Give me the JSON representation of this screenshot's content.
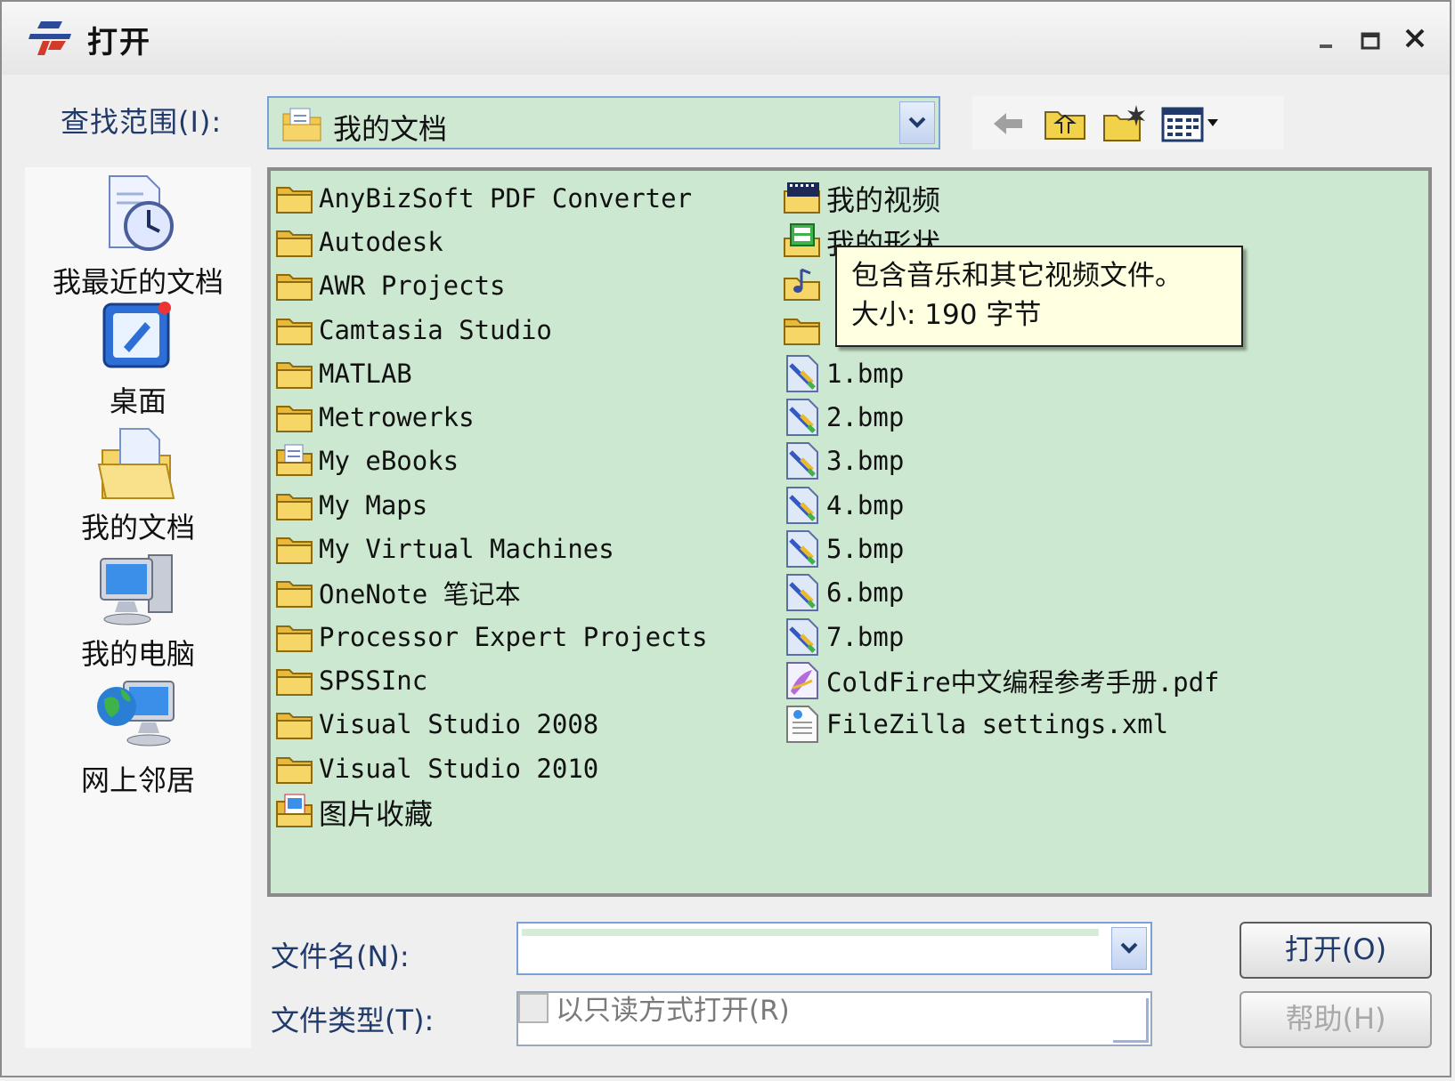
{
  "window": {
    "title": "打开"
  },
  "lookin": {
    "label": "查找范围(I):",
    "value": "我的文档"
  },
  "places": [
    {
      "label": "我最近的文档",
      "icon": "recent-documents-icon"
    },
    {
      "label": "桌面",
      "icon": "desktop-icon"
    },
    {
      "label": "我的文档",
      "icon": "my-documents-icon"
    },
    {
      "label": "我的电脑",
      "icon": "my-computer-icon"
    },
    {
      "label": "网上邻居",
      "icon": "network-places-icon"
    }
  ],
  "files_left": [
    {
      "name": "AnyBizSoft PDF Converter",
      "icon": "folder-icon"
    },
    {
      "name": "Autodesk",
      "icon": "folder-icon"
    },
    {
      "name": "AWR Projects",
      "icon": "folder-icon"
    },
    {
      "name": "Camtasia Studio",
      "icon": "folder-icon"
    },
    {
      "name": "MATLAB",
      "icon": "folder-icon"
    },
    {
      "name": "Metrowerks",
      "icon": "folder-icon"
    },
    {
      "name": "My eBooks",
      "icon": "ebook-folder-icon"
    },
    {
      "name": "My Maps",
      "icon": "folder-icon"
    },
    {
      "name": "My Virtual Machines",
      "icon": "folder-icon"
    },
    {
      "name": "OneNote 笔记本",
      "icon": "folder-icon"
    },
    {
      "name": "Processor Expert Projects",
      "icon": "folder-icon"
    },
    {
      "name": "SPSSInc",
      "icon": "folder-icon"
    },
    {
      "name": "Visual Studio 2008",
      "icon": "folder-icon"
    },
    {
      "name": "Visual Studio 2010",
      "icon": "folder-icon"
    },
    {
      "name": "图片收藏",
      "icon": "pictures-folder-icon"
    }
  ],
  "files_right": [
    {
      "name": "我的视频",
      "icon": "video-folder-icon"
    },
    {
      "name": "我的形状",
      "icon": "shapes-folder-icon"
    },
    {
      "name": "",
      "icon": "music-folder-icon"
    },
    {
      "name": "",
      "icon": "folder-icon"
    },
    {
      "name": "1.bmp",
      "icon": "bmp-file-icon"
    },
    {
      "name": "2.bmp",
      "icon": "bmp-file-icon"
    },
    {
      "name": "3.bmp",
      "icon": "bmp-file-icon"
    },
    {
      "name": "4.bmp",
      "icon": "bmp-file-icon"
    },
    {
      "name": "5.bmp",
      "icon": "bmp-file-icon"
    },
    {
      "name": "6.bmp",
      "icon": "bmp-file-icon"
    },
    {
      "name": "7.bmp",
      "icon": "bmp-file-icon"
    },
    {
      "name": "ColdFire中文编程参考手册.pdf",
      "icon": "pdf-file-icon"
    },
    {
      "name": "FileZilla settings.xml",
      "icon": "xml-file-icon"
    }
  ],
  "tooltip": {
    "line1": "包含音乐和其它视频文件。",
    "line2": "大小: 190 字节"
  },
  "filename": {
    "label": "文件名(N):",
    "value": ""
  },
  "filetype": {
    "label": "文件类型(T):"
  },
  "readonly": {
    "label": "以只读方式打开(R)"
  },
  "buttons": {
    "open": "打开(O)",
    "help": "帮助(H)"
  },
  "colors": {
    "list_bg": "#cce8d0",
    "accent": "#7aa0d8",
    "label": "#1f3a6b",
    "tooltip_bg": "#ffffe1"
  }
}
